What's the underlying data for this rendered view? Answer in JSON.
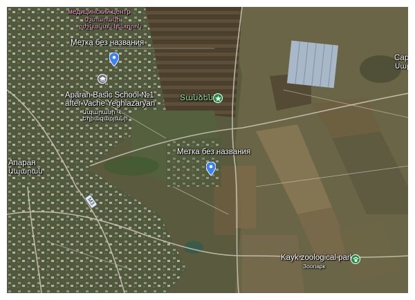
{
  "map": {
    "labels": {
      "medical_center": "медицинский центр",
      "medical_center_sub1": "Աշտարակի",
      "medical_center_sub2": "բժշկական կենտրոն",
      "place1": "Метка без названия",
      "school_line1": "Aparan Basic School №1",
      "school_line2": "after Vache Yeghiazaryan",
      "school_sub1": "Ապարանի Վ.",
      "school_sub2": "Եղիազարյանի",
      "church": "Տանձենի",
      "place2": "Метка без названия",
      "town_ru": "Апаран",
      "town_hy": "Ապարան",
      "road_number": "M3",
      "park": "Kayk zoological park",
      "park_sub": "Зоопарк",
      "edge_right1": "Сар",
      "edge_right2": "Սար"
    },
    "colors": {
      "pin": "#3b82f6",
      "park_icon": "#1e8e3e",
      "school_icon": "#6b7280",
      "medical_text": "#f3a9c8"
    }
  }
}
